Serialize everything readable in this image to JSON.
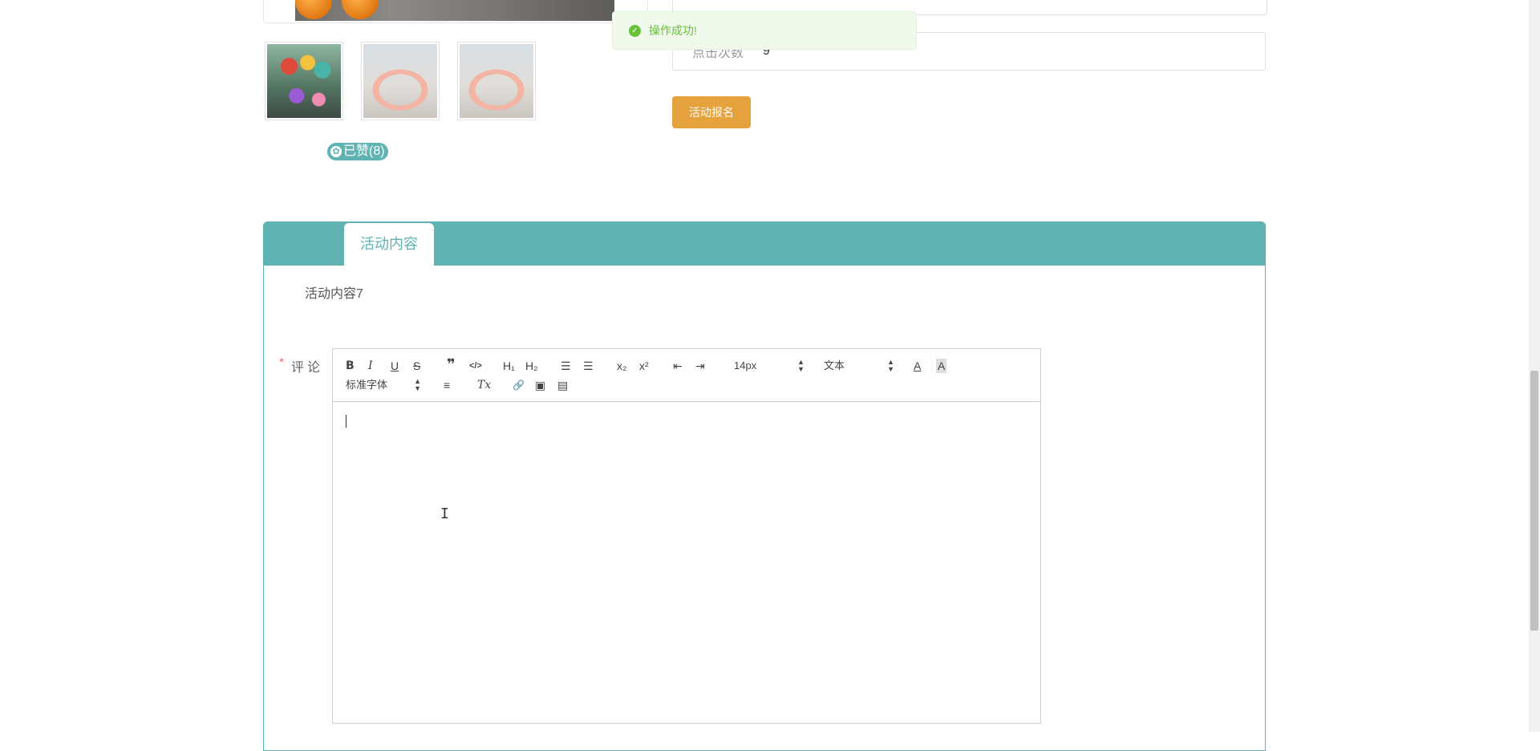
{
  "gallery": {
    "thumbnails": [
      "thumb-1",
      "thumb-2",
      "thumb-3"
    ],
    "liked_label": "已赞(8)"
  },
  "info": {
    "clicks_label": "点击次数",
    "clicks_value": "9",
    "signup_button": "活动报名"
  },
  "toast": {
    "message": "操作成功!"
  },
  "tabs": {
    "active": "活动内容"
  },
  "content": {
    "text": "活动内容7"
  },
  "comment": {
    "required_mark": "*",
    "label": "评论",
    "toolbar": {
      "bold": "B",
      "italic": "I",
      "underline": "U",
      "strike": "S",
      "blockquote": "❞",
      "code": "</>",
      "h1": "H₁",
      "h2": "H₂",
      "ordered_list": "☰",
      "bullet_list": "☰",
      "subscript": "x₂",
      "superscript": "x²",
      "outdent": "⇤",
      "indent": "⇥",
      "size": "14px",
      "header": "文本",
      "font": "标准字体",
      "align": "≡",
      "clean": "Tx",
      "link": "🔗",
      "image": "▣",
      "video": "▤"
    }
  }
}
